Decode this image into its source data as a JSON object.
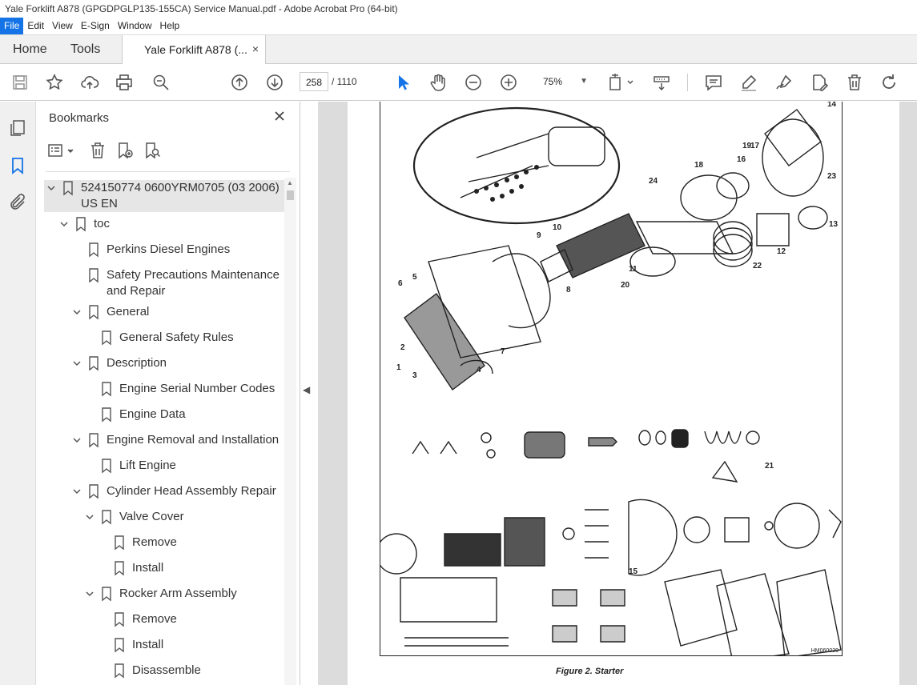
{
  "window": {
    "title": "Yale Forklift A878 (GPGDPGLP135-155CA) Service Manual.pdf - Adobe Acrobat Pro (64-bit)"
  },
  "menu": [
    "File",
    "Edit",
    "View",
    "E-Sign",
    "Window",
    "Help"
  ],
  "tabs": {
    "home": "Home",
    "tools": "Tools",
    "document": "Yale Forklift A878 (...",
    "close": "×"
  },
  "toolbar": {
    "page_current": "258",
    "page_total": "/  1110",
    "zoom": "75%"
  },
  "bookmarks": {
    "title": "Bookmarks",
    "items": [
      {
        "label": "524150774 0600YRM0705 (03 2006)",
        "label2": "US EN"
      },
      {
        "label": "toc"
      },
      {
        "label": "Perkins Diesel Engines"
      },
      {
        "label": "Safety Precautions Maintenance",
        "label2": "and Repair"
      },
      {
        "label": "General"
      },
      {
        "label": "General Safety Rules"
      },
      {
        "label": "Description"
      },
      {
        "label": "Engine Serial Number Codes"
      },
      {
        "label": "Engine Data"
      },
      {
        "label": "Engine Removal and Installation"
      },
      {
        "label": "Lift Engine"
      },
      {
        "label": "Cylinder Head Assembly Repair"
      },
      {
        "label": "Valve Cover"
      },
      {
        "label": "Remove"
      },
      {
        "label": "Install"
      },
      {
        "label": "Rocker Arm Assembly"
      },
      {
        "label": "Remove"
      },
      {
        "label": "Install"
      },
      {
        "label": "Disassemble"
      }
    ]
  },
  "figure": {
    "caption": "Figure 2. Starter",
    "code": "HM060020",
    "callouts": [
      "1",
      "2",
      "3",
      "4",
      "5",
      "6",
      "7",
      "8",
      "9",
      "10",
      "11",
      "12",
      "13",
      "14",
      "15",
      "16",
      "17",
      "18",
      "19",
      "20",
      "21",
      "22",
      "23",
      "24"
    ]
  }
}
